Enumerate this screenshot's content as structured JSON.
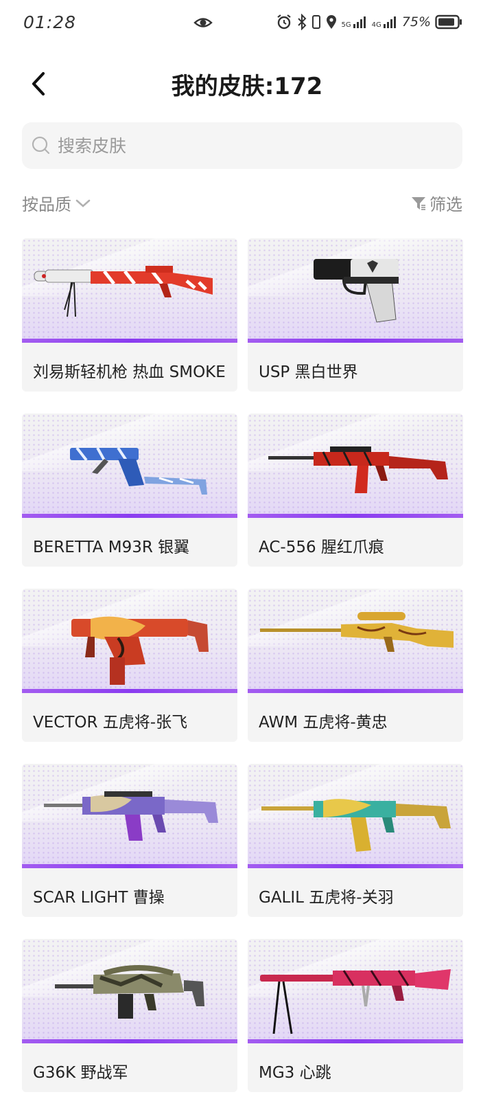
{
  "status": {
    "time": "01:28",
    "battery": "75%",
    "signal_5g": "5G",
    "signal_4g": "4G"
  },
  "header": {
    "title": "我的皮肤:172"
  },
  "search": {
    "placeholder": "搜索皮肤"
  },
  "filters": {
    "sort_label": "按品质",
    "filter_label": "筛选"
  },
  "accent_color": "#8a3cf0",
  "skins": [
    {
      "name": "刘易斯轻机枪 热血 SMOKE"
    },
    {
      "name": "USP 黑白世界"
    },
    {
      "name": "BERETTA M93R  银翼"
    },
    {
      "name": "AC-556 腥红爪痕"
    },
    {
      "name": "VECTOR 五虎将-张飞"
    },
    {
      "name": "AWM 五虎将-黄忠"
    },
    {
      "name": "SCAR LIGHT 曹操"
    },
    {
      "name": "GALIL 五虎将-关羽"
    },
    {
      "name": "G36K 野战军"
    },
    {
      "name": "MG3 心跳"
    }
  ]
}
